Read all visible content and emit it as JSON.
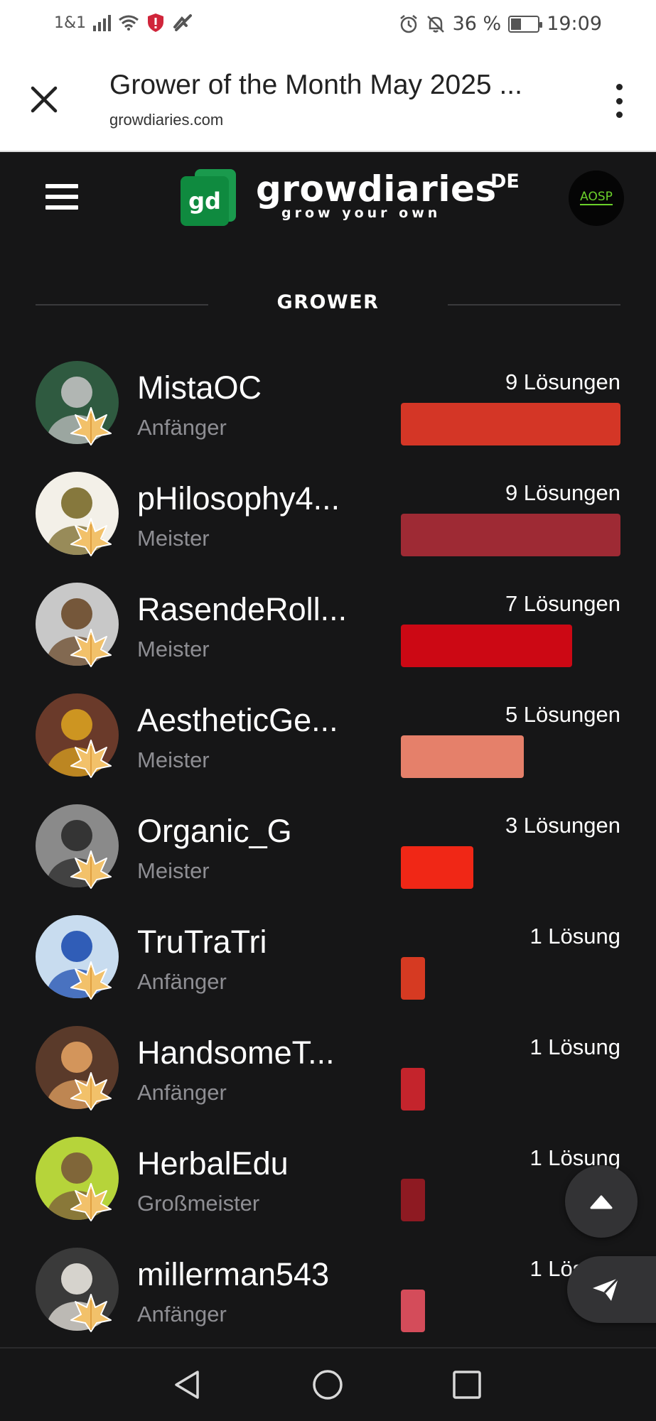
{
  "status_bar": {
    "carrier": "1&1",
    "battery": "36 %",
    "time": "19:09"
  },
  "browser": {
    "title": "Grower of the Month May 2025 ...",
    "url": "growdiaries.com"
  },
  "site": {
    "logo_short": "gd",
    "logo_name": "growdiaries",
    "logo_tagline": "grow your own",
    "language": "DE",
    "user_avatar_text": "AOSP"
  },
  "section": {
    "title": "GROWER"
  },
  "growers": [
    {
      "name": "MistaOC",
      "level": "Anfänger",
      "count": "9 Lösungen",
      "value": 9,
      "bar_color": "#d43626",
      "avatar_color": "#2f5a40",
      "avatar_accent": "#c0c0c0"
    },
    {
      "name": "pHilosophy4...",
      "level": "Meister",
      "count": "9 Lösungen",
      "value": 9,
      "bar_color": "#9e2a34",
      "avatar_color": "#f3f0e8",
      "avatar_accent": "#7a6a2a"
    },
    {
      "name": "RasendeRoll...",
      "level": "Meister",
      "count": "7 Lösungen",
      "value": 7,
      "bar_color": "#cc0814",
      "avatar_color": "#c8c8c8",
      "avatar_accent": "#6b4a2a"
    },
    {
      "name": "AestheticGe...",
      "level": "Meister",
      "count": "5 Lösungen",
      "value": 5,
      "bar_color": "#e5806a",
      "avatar_color": "#6a3a2a",
      "avatar_accent": "#d8a020"
    },
    {
      "name": "Organic_G",
      "level": "Meister",
      "count": "3 Lösungen",
      "value": 3,
      "bar_color": "#f02716",
      "avatar_color": "#8a8a8a",
      "avatar_accent": "#2a2a2a"
    },
    {
      "name": "TruTraTri",
      "level": "Anfänger",
      "count": "1 Lösung",
      "value": 1,
      "bar_color": "#d63a22",
      "avatar_color": "#c8dcef",
      "avatar_accent": "#1f4fb0"
    },
    {
      "name": "HandsomeT...",
      "level": "Anfänger",
      "count": "1 Lösung",
      "value": 1,
      "bar_color": "#c4242c",
      "avatar_color": "#5a3a2a",
      "avatar_accent": "#e0a060"
    },
    {
      "name": "HerbalEdu",
      "level": "Großmeister",
      "count": "1 Lösung",
      "value": 1,
      "bar_color": "#8e1a22",
      "avatar_color": "#b6d43a",
      "avatar_accent": "#7a5a3a"
    },
    {
      "name": "millerman543",
      "level": "Anfänger",
      "count": "1 Lösung",
      "value": 1,
      "bar_color": "#d44c5a",
      "avatar_color": "#3a3a3a",
      "avatar_accent": "#e8e4de"
    }
  ],
  "icons": {
    "close": "close-icon",
    "more": "more-vert-icon",
    "menu": "hamburger-icon",
    "scroll_top": "chevron-up-icon",
    "send": "send-icon",
    "back": "nav-back-icon",
    "home": "nav-home-icon",
    "recents": "nav-recents-icon"
  }
}
